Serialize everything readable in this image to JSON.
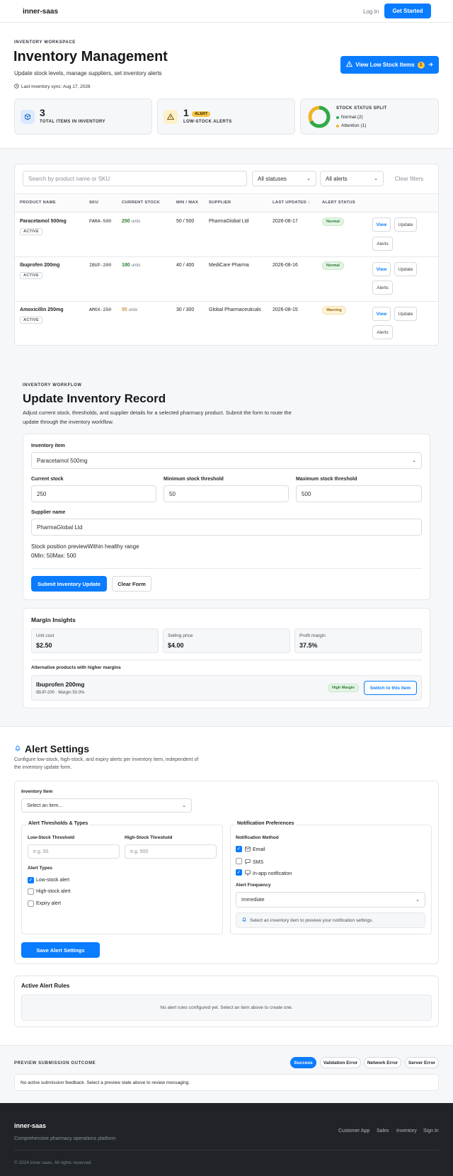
{
  "nav": {
    "brand": "inner-saas",
    "login": "Log In",
    "get_started": "Get Started"
  },
  "hero": {
    "eyebrow": "INVENTORY WORKSPACE",
    "title": "Inventory Management",
    "subtitle": "Update stock levels, manage suppliers, set inventory alerts",
    "sync": "Last inventory sync: Aug 17, 2026",
    "low_stock_button": "View Low Stock Items",
    "low_stock_count": "1"
  },
  "kpis": {
    "total_value": "3",
    "total_label": "TOTAL ITEMS IN INVENTORY",
    "alerts_value": "1",
    "alerts_pill": "ALERT",
    "alerts_label": "LOW-STOCK ALERTS",
    "split_title": "STOCK STATUS SPLIT",
    "split_normal": "Normal (2)",
    "split_attention": "Attention (1)",
    "split_normal_fraction": 0.667,
    "colors": {
      "normal": "#2eaa4a",
      "attention": "#f0b429"
    }
  },
  "filters": {
    "search_placeholder": "Search by product name or SKU",
    "status_select": "All statuses",
    "alert_select": "All alerts",
    "clear": "Clear filters"
  },
  "table": {
    "headers": [
      "PRODUCT NAME",
      "SKU",
      "CURRENT STOCK",
      "MIN / MAX",
      "SUPPLIER",
      "LAST UPDATED ↓",
      "ALERT STATUS"
    ],
    "rows": [
      {
        "name": "Paracetamol 500mg",
        "badge": "ACTIVE",
        "sku": "PARA-500",
        "stock": "250",
        "unit": "units",
        "minmax": "50 / 500",
        "supplier": "PharmaGlobal Ltd",
        "updated": "2026-08-17",
        "status": "Normal",
        "view": "View",
        "update": "Update",
        "alerts": "Alerts"
      },
      {
        "name": "Ibuprofen 200mg",
        "badge": "ACTIVE",
        "sku": "IBUP-200",
        "stock": "180",
        "unit": "units",
        "minmax": "40 / 400",
        "supplier": "MediCare Pharma",
        "updated": "2026-08-16",
        "status": "Normal",
        "view": "View",
        "update": "Update",
        "alerts": "Alerts"
      },
      {
        "name": "Amoxicillin 250mg",
        "badge": "ACTIVE",
        "sku": "AMOX-250",
        "stock": "95",
        "unit": "units",
        "minmax": "30 / 300",
        "supplier": "Global Pharmaceuticals",
        "updated": "2026-08-15",
        "status": "Warning",
        "view": "View",
        "update": "Update",
        "alerts": "Alerts"
      }
    ]
  },
  "workflow": {
    "eyebrow": "INVENTORY WORKFLOW",
    "title": "Update Inventory Record",
    "desc1": "Adjust current stock, thresholds, and supplier details for a selected pharmacy product. Submit the form to route the",
    "desc2": "update through the inventory workflow.",
    "item_label": "Inventory item",
    "item_value": "Paracetamol 500mg",
    "current_label": "Current stock",
    "current_value": "250",
    "min_label": "Minimum stock threshold",
    "min_value": "50",
    "max_label": "Maximum stock threshold",
    "max_value": "500",
    "supplier_label": "Supplier name",
    "supplier_value": "PharmaGlobal Ltd",
    "preview_line1": "Stock position previewWithin healthy range",
    "preview_line2": "0Min: 50Max: 500",
    "submit": "Submit Inventory Update",
    "clear": "Clear Form"
  },
  "margin": {
    "title": "Margin Insights",
    "unit_cost_label": "Unit cost",
    "unit_cost": "$2.50",
    "selling_label": "Selling price",
    "selling": "$4.00",
    "profit_label": "Profit margin",
    "profit": "37.5%",
    "alt_title": "Alternative products with higher margins",
    "alt_name": "Ibuprofen 200mg",
    "alt_meta": "IBUP-200 · Margin 50.0%",
    "alt_badge": "High Margin",
    "alt_button": "Switch to this item"
  },
  "alerts": {
    "title": "Alert Settings",
    "desc1": "Configure low-stock, high-stock, and expiry alerts per inventory item, independent of",
    "desc2": "the inventory update form.",
    "item_label": "Inventory Item",
    "item_placeholder": "Select an item...",
    "thresholds_legend": "Alert Thresholds & Types",
    "low_label": "Low-Stock Threshold",
    "low_placeholder": "e.g. 50",
    "high_label": "High-Stock Threshold",
    "high_placeholder": "e.g. 500",
    "types_label": "Alert Types",
    "type_low": "Low-stock alert",
    "type_high": "High-stock alert",
    "type_expiry": "Expiry alert",
    "notif_legend": "Notification Preferences",
    "method_label": "Notification Method",
    "email": "Email",
    "sms": "SMS",
    "inapp": "In-app notification",
    "freq_label": "Alert Frequency",
    "freq_value": "Immediate",
    "hint": "Select an inventory item to preview your notification settings.",
    "save": "Save Alert Settings",
    "rules_title": "Active Alert Rules",
    "rules_empty": "No alert rules configured yet. Select an item above to create one."
  },
  "preview": {
    "title": "PREVIEW SUBMISSION OUTCOME",
    "tabs": [
      "Success",
      "Validation Error",
      "Network Error",
      "Server Error"
    ],
    "message": "No active submission feedback. Select a preview state above to review messaging."
  },
  "footer": {
    "brand": "inner-saas",
    "tagline": "Comprehensive pharmacy operations platform",
    "links": [
      "Customer App",
      "Sales",
      "Inventory",
      "Sign In"
    ],
    "copyright": "© 2024 inner-saas. All rights reserved."
  }
}
